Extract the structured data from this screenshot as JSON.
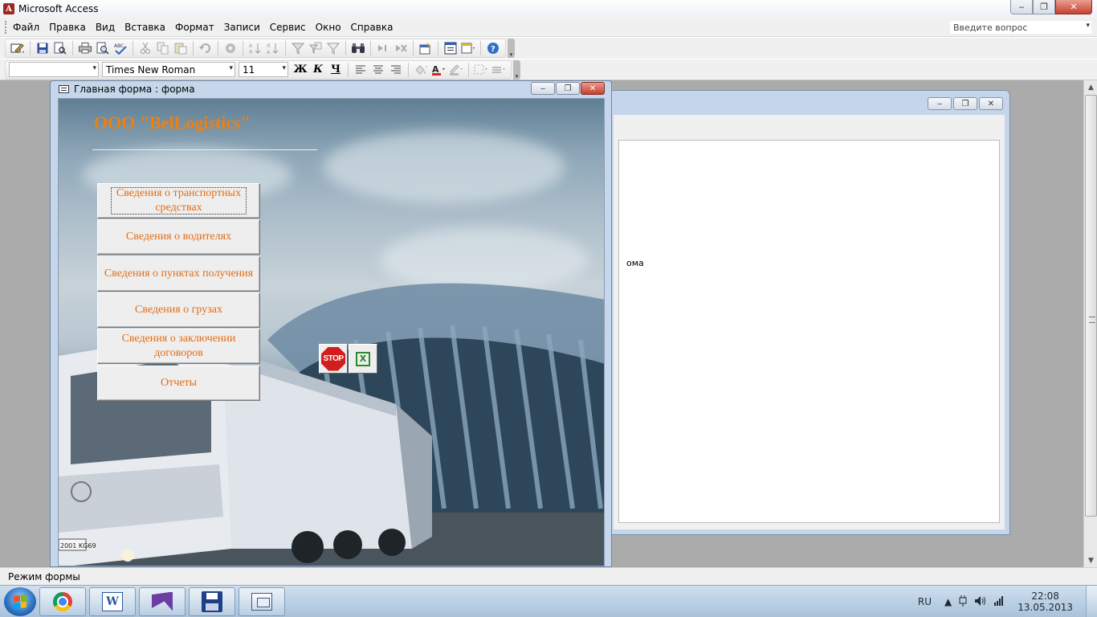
{
  "app": {
    "title": "Microsoft Access",
    "icon_letter": "A",
    "window_buttons": {
      "minimize": "‒",
      "restore": "❐",
      "close": "✕"
    }
  },
  "menubar": {
    "items": [
      "Файл",
      "Правка",
      "Вид",
      "Вставка",
      "Формат",
      "Записи",
      "Сервис",
      "Окно",
      "Справка"
    ],
    "help_placeholder": "Введите вопрос",
    "help_dropdown": "▾"
  },
  "toolbar_format": {
    "object_combo": "",
    "font_name": "Times New Roman",
    "font_size": "11",
    "bold": "Ж",
    "italic": "К",
    "underline": "Ч"
  },
  "form_window": {
    "title": "Главная форма : форма",
    "heading": "ООО \"BelLogistics\"",
    "buttons": [
      "Сведения о транспортных средствах",
      "Сведения о водителях",
      "Сведения о пунктах получения",
      "Сведения о грузах",
      "Сведения о заключении договоров",
      "Отчеты"
    ],
    "stop_label": "STOP",
    "excel_label": "X",
    "plate": "2001 KG69"
  },
  "background_window": {
    "text_fragment": "ома"
  },
  "statusbar": {
    "text": "Режим формы"
  },
  "taskbar": {
    "language": "RU",
    "time": "22:08",
    "date": "13.05.2013",
    "word_label": "W"
  }
}
